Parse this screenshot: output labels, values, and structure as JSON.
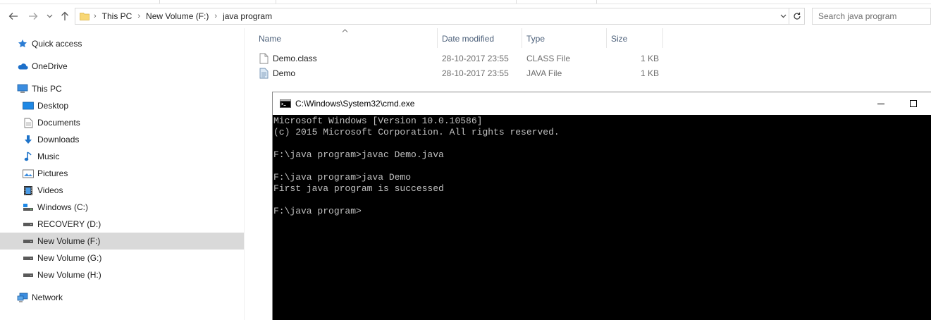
{
  "address_bar": {
    "crumbs": [
      "This PC",
      "New Volume (F:)",
      "java program"
    ],
    "search_placeholder": "Search java program"
  },
  "nav_pane": {
    "quick_access": "Quick access",
    "onedrive": "OneDrive",
    "this_pc": "This PC",
    "items": [
      {
        "label": "Desktop",
        "icon": "desktop-icon"
      },
      {
        "label": "Documents",
        "icon": "documents-icon"
      },
      {
        "label": "Downloads",
        "icon": "downloads-icon"
      },
      {
        "label": "Music",
        "icon": "music-icon"
      },
      {
        "label": "Pictures",
        "icon": "pictures-icon"
      },
      {
        "label": "Videos",
        "icon": "videos-icon"
      },
      {
        "label": "Windows (C:)",
        "icon": "drive-icon"
      },
      {
        "label": "RECOVERY (D:)",
        "icon": "drive-icon"
      },
      {
        "label": "New Volume (F:)",
        "icon": "drive-icon",
        "selected": true
      },
      {
        "label": "New Volume (G:)",
        "icon": "drive-icon"
      },
      {
        "label": "New Volume (H:)",
        "icon": "drive-icon"
      }
    ],
    "network": "Network"
  },
  "file_list": {
    "columns": [
      "Name",
      "Date modified",
      "Type",
      "Size"
    ],
    "rows": [
      {
        "name": "Demo.class",
        "date": "28-10-2017 23:55",
        "type": "CLASS File",
        "size": "1 KB"
      },
      {
        "name": "Demo",
        "date": "28-10-2017 23:55",
        "type": "JAVA File",
        "size": "1 KB"
      }
    ]
  },
  "cmd": {
    "title": "C:\\Windows\\System32\\cmd.exe",
    "lines": [
      "Microsoft Windows [Version 10.0.10586]",
      "(c) 2015 Microsoft Corporation. All rights reserved.",
      "",
      "F:\\java program>javac Demo.java",
      "",
      "F:\\java program>java Demo",
      "First java program is successed",
      "",
      "F:\\java program>"
    ]
  },
  "colors": {
    "selected_bg": "#d9d9d9",
    "header_text": "#4c607a",
    "console_bg": "#000000",
    "console_text": "#c0c0c0"
  }
}
